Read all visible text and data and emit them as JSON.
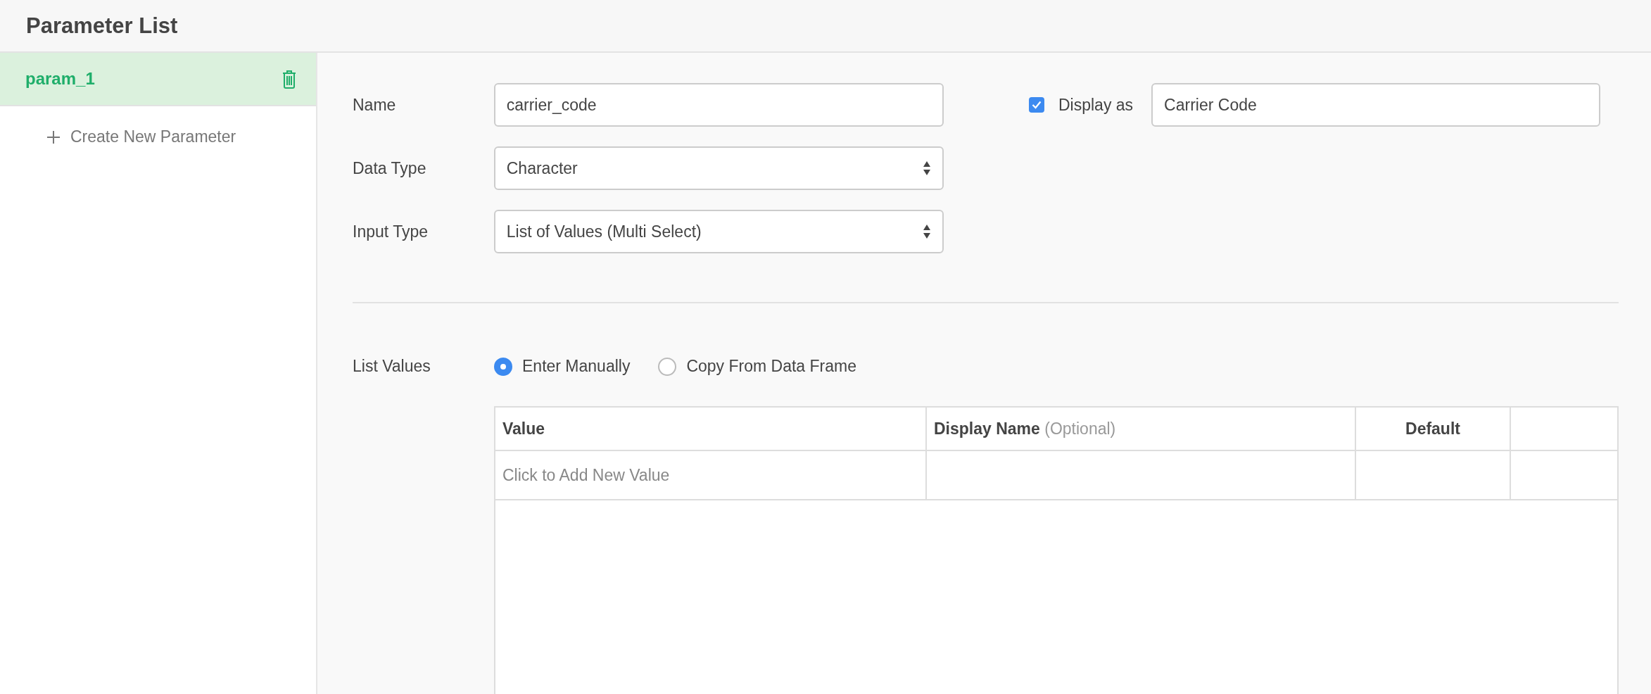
{
  "header": {
    "title": "Parameter List"
  },
  "sidebar": {
    "items": [
      {
        "label": "param_1",
        "selected": true
      }
    ],
    "create_label": "Create New Parameter"
  },
  "form": {
    "fields": [
      {
        "kind": "text",
        "label": "Name",
        "value": "carrier_code"
      },
      {
        "kind": "select",
        "label": "Data Type",
        "value": "Character"
      },
      {
        "kind": "select",
        "label": "Input Type",
        "value": "List of Values (Multi Select)"
      }
    ],
    "display_as": {
      "label": "Display as",
      "checked": true,
      "value": "Carrier Code"
    },
    "list_values": {
      "label": "List Values",
      "options": [
        {
          "label": "Enter Manually",
          "selected": true
        },
        {
          "label": "Copy From Data Frame",
          "selected": false
        }
      ]
    }
  },
  "table": {
    "columns": [
      {
        "label": "Value"
      },
      {
        "label": "**Display Name** (Optional)"
      },
      {
        "label": "Default"
      }
    ],
    "rows": [
      {
        "placeholder": "Click to Add New Value"
      }
    ]
  }
}
